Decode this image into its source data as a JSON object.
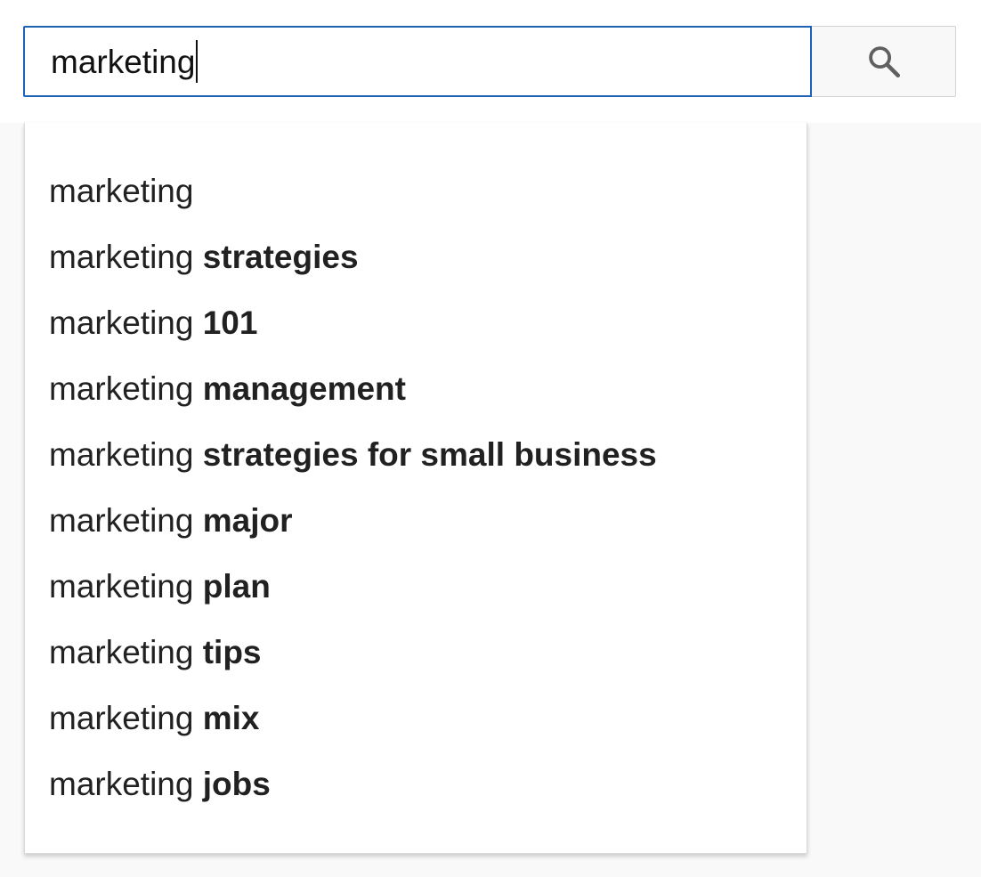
{
  "search": {
    "value": "marketing",
    "icon": "search-icon"
  },
  "suggestions": [
    {
      "prefix": "marketing",
      "completion": ""
    },
    {
      "prefix": "marketing",
      "completion": "strategies"
    },
    {
      "prefix": "marketing",
      "completion": "101"
    },
    {
      "prefix": "marketing",
      "completion": "management"
    },
    {
      "prefix": "marketing",
      "completion": "strategies for small business"
    },
    {
      "prefix": "marketing",
      "completion": "major"
    },
    {
      "prefix": "marketing",
      "completion": "plan"
    },
    {
      "prefix": "marketing",
      "completion": "tips"
    },
    {
      "prefix": "marketing",
      "completion": "mix"
    },
    {
      "prefix": "marketing",
      "completion": "jobs"
    }
  ],
  "colors": {
    "focus_border": "#1c62b9",
    "text": "#212121",
    "page_background": "#f9f9f9",
    "button_background": "#f8f8f8"
  }
}
